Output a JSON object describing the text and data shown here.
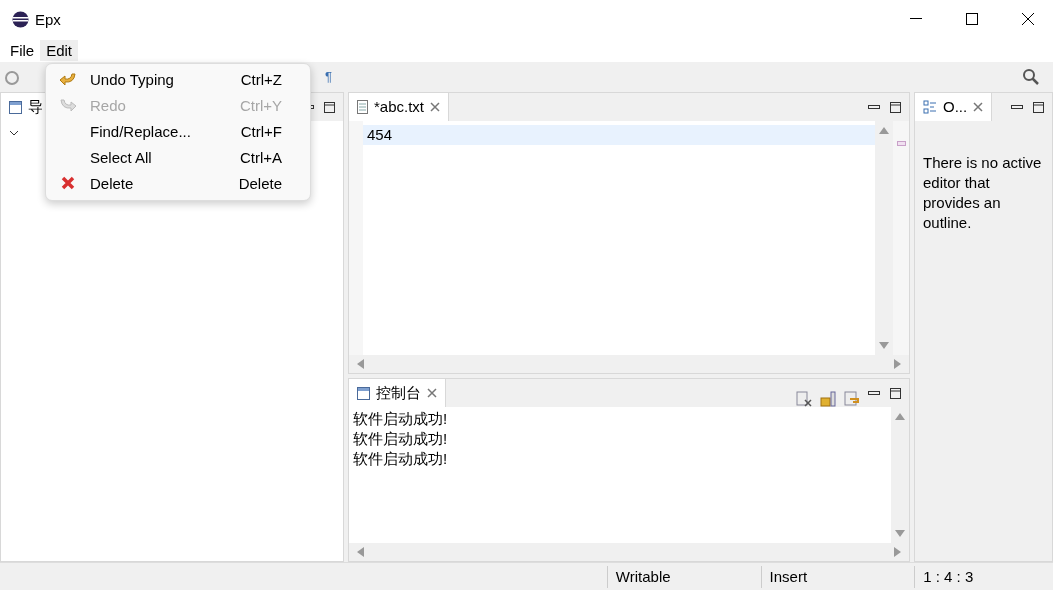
{
  "window": {
    "title": "Epx"
  },
  "menu_bar": [
    {
      "label": "File",
      "selected": false
    },
    {
      "label": "Edit",
      "selected": true
    }
  ],
  "edit_menu": [
    {
      "kind": "undo",
      "label": "Undo Typing",
      "shortcut": "Ctrl+Z",
      "disabled": false
    },
    {
      "kind": "redo",
      "label": "Redo",
      "shortcut": "Ctrl+Y",
      "disabled": true
    },
    {
      "kind": "plain",
      "label": "Find/Replace...",
      "shortcut": "Ctrl+F",
      "disabled": false
    },
    {
      "kind": "plain",
      "label": "Select All",
      "shortcut": "Ctrl+A",
      "disabled": false
    },
    {
      "kind": "delete",
      "label": "Delete",
      "shortcut": "Delete",
      "disabled": false
    }
  ],
  "toolbar": {
    "pilcrow": "¶"
  },
  "navigator": {
    "title": "导"
  },
  "editor": {
    "tab": "*abc.txt",
    "lines": [
      "454"
    ]
  },
  "console": {
    "tab": "控制台",
    "lines": [
      "软件启动成功!",
      "软件启动成功!",
      "软件启动成功!"
    ]
  },
  "outline": {
    "tab": "O...",
    "message": "There is no active editor that provides an outline."
  },
  "status_bar": [
    "Writable",
    "Insert",
    "1 : 4 : 3"
  ]
}
